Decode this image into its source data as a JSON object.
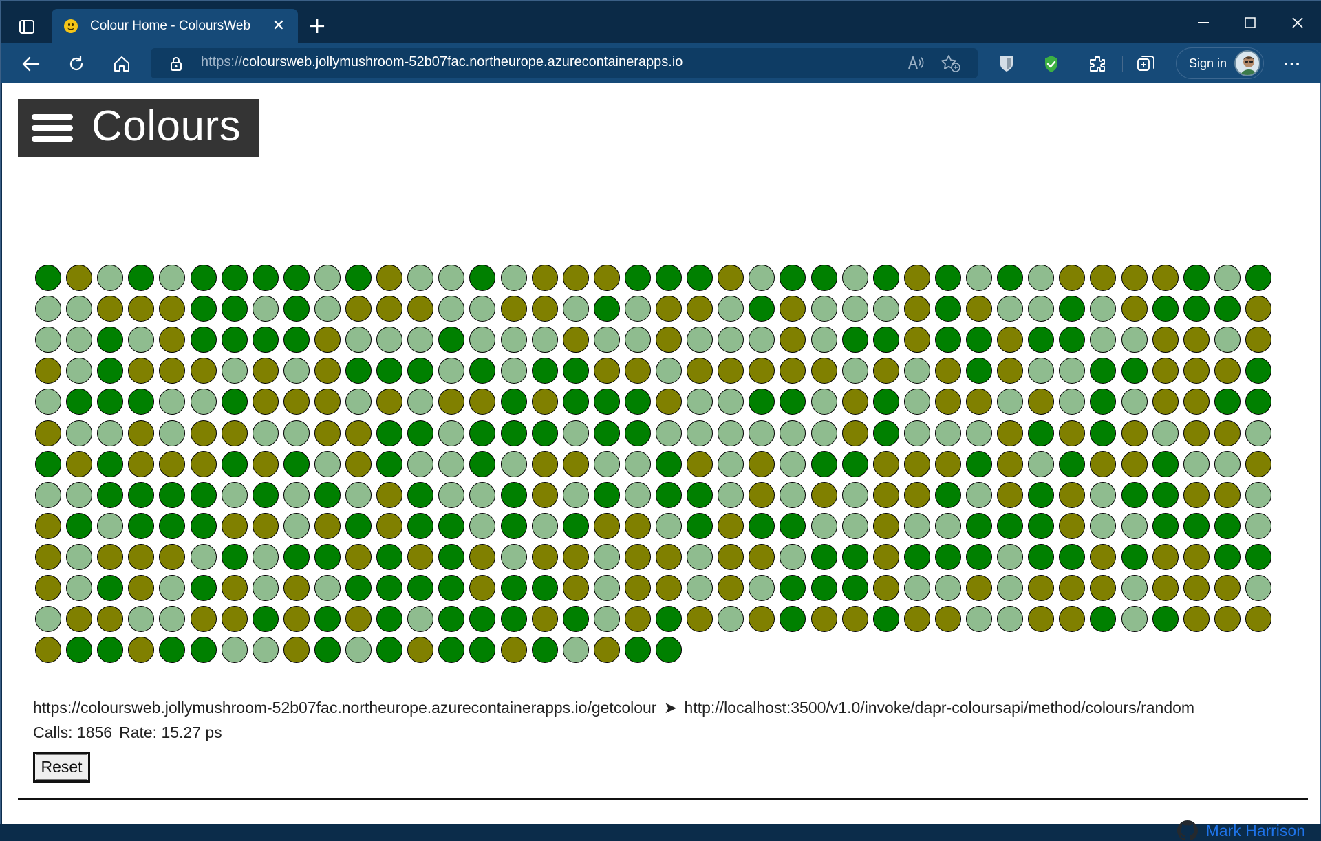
{
  "browser": {
    "tab": {
      "title": "Colour Home - ColoursWeb",
      "close_glyph": "✕"
    },
    "new_tab_glyph": "+",
    "address": {
      "scheme": "https://",
      "host_path": "coloursweb.jollymushroom-52b07fac.northeurope.azurecontainerapps.io"
    },
    "signin_label": "Sign in",
    "more_glyph": "···"
  },
  "app": {
    "brand_title": "Colours",
    "colors": {
      "G": "#008000",
      "O": "#808000",
      "L": "#8fbc8f"
    },
    "grid_rows": [
      "GOLGLGGGGLGOLLGLOOOGGGOLGGLGOGLGLOOOOGLG",
      "LLOOOGGLGLOOOLLOOLGLOOLGOLLLOGOLLGLOGGGO",
      "LLGLOGGGGOLLLGLLLOLLOLLLOLGGOGGOGGLLOOLO",
      "OLGOOOLOLOGGGLGLGGOOLOOOOOLOLOGOLLGGOOOG",
      "LGGGLLGOOOLOLOOGOGGGOLLGGLOGLOOLOLGLOOGG",
      "OLLOLOOLLOOGGLGGGLGGLLLLLLOGLLLOGOGOLOOL",
      "GOGOOOGOGLOGLLGLOOLLGOLOLGGOOOGOLGOOGLLO",
      "LLGGGGLGLGLOGLLGOLGLGGLOLOLOOGLOGOLGGOOL",
      "OGLGGGOOLOGOGGLGLGOOLGOGGLLOLLGGGOLLGGGL",
      "OLOOOLGLGGOGOGOLOOLOOLOOLGGOGGGLGGOGOOGG",
      "OLGOLGOLOLGGGGOGGOLOOLOLGGGOLLOLOOOLOOOL",
      "LOOLLOOGOGOGLGGGOGLOGOLOGOOGOOLLOOGLGOOO",
      "OGGOGGLLOGLGOGGOGLOGG"
    ],
    "endpoint_from": "https://coloursweb.jollymushroom-52b07fac.northeurope.azurecontainerapps.io/getcolour",
    "arrow_glyph": "➤",
    "endpoint_to": "http://localhost:3500/v1.0/invoke/dapr-coloursapi/method/colours/random",
    "calls_label": "Calls: 1856",
    "rate_label": "Rate: 15.27 ps",
    "reset_label": "Reset",
    "footer_link": "Mark Harrison"
  }
}
